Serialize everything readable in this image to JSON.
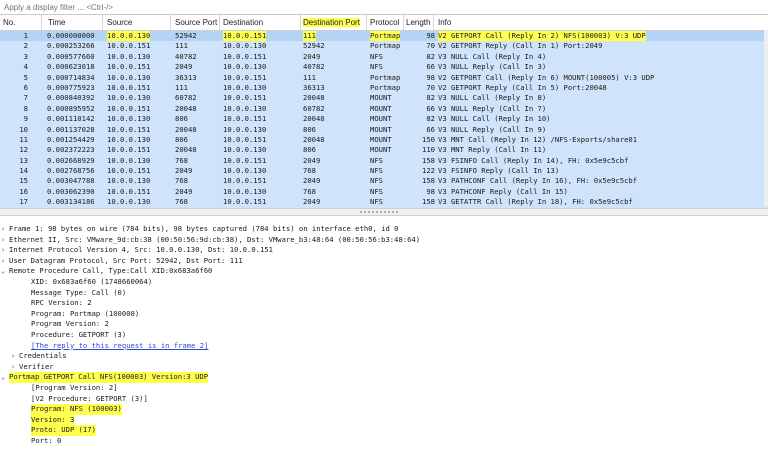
{
  "filter": {
    "placeholder": "Apply a display filter ... <Ctrl-/>"
  },
  "columns": {
    "no": "No.",
    "time": "Time",
    "source": "Source",
    "source_port": "Source Port",
    "destination": "Destination",
    "destination_port": "Destination Port",
    "protocol": "Protocol",
    "length": "Length",
    "info": "Info"
  },
  "packets": [
    {
      "no": "1",
      "time": "0.000000000",
      "src": "10.0.0.130",
      "sport": "52942",
      "dst": "10.0.0.151",
      "dport": "111",
      "proto": "Portmap",
      "len": "98",
      "info": "V2 GETPORT Call (Reply In 2) NFS(100003) V:3 UDP"
    },
    {
      "no": "2",
      "time": "0.000253266",
      "src": "10.0.0.151",
      "sport": "111",
      "dst": "10.0.0.130",
      "dport": "52942",
      "proto": "Portmap",
      "len": "70",
      "info": "V2 GETPORT Reply (Call In 1) Port:2049"
    },
    {
      "no": "3",
      "time": "0.000577660",
      "src": "10.0.0.130",
      "sport": "40782",
      "dst": "10.0.0.151",
      "dport": "2049",
      "proto": "NFS",
      "len": "82",
      "info": "V3 NULL Call (Reply In 4)"
    },
    {
      "no": "4",
      "time": "0.000623018",
      "src": "10.0.0.151",
      "sport": "2049",
      "dst": "10.0.0.130",
      "dport": "40782",
      "proto": "NFS",
      "len": "66",
      "info": "V3 NULL Reply (Call In 3)"
    },
    {
      "no": "5",
      "time": "0.000714834",
      "src": "10.0.0.130",
      "sport": "36313",
      "dst": "10.0.0.151",
      "dport": "111",
      "proto": "Portmap",
      "len": "98",
      "info": "V2 GETPORT Call (Reply In 6) MOUNT(100005) V:3 UDP"
    },
    {
      "no": "6",
      "time": "0.000775923",
      "src": "10.0.0.151",
      "sport": "111",
      "dst": "10.0.0.130",
      "dport": "36313",
      "proto": "Portmap",
      "len": "70",
      "info": "V2 GETPORT Reply (Call In 5) Port:20048"
    },
    {
      "no": "7",
      "time": "0.000840392",
      "src": "10.0.0.130",
      "sport": "60782",
      "dst": "10.0.0.151",
      "dport": "20048",
      "proto": "MOUNT",
      "len": "82",
      "info": "V3 NULL Call (Reply In 8)"
    },
    {
      "no": "8",
      "time": "0.000895952",
      "src": "10.0.0.151",
      "sport": "20048",
      "dst": "10.0.0.130",
      "dport": "60782",
      "proto": "MOUNT",
      "len": "66",
      "info": "V3 NULL Reply (Call In 7)"
    },
    {
      "no": "9",
      "time": "0.001110142",
      "src": "10.0.0.130",
      "sport": "806",
      "dst": "10.0.0.151",
      "dport": "20048",
      "proto": "MOUNT",
      "len": "82",
      "info": "V3 NULL Call (Reply In 10)"
    },
    {
      "no": "10",
      "time": "0.001137028",
      "src": "10.0.0.151",
      "sport": "20048",
      "dst": "10.0.0.130",
      "dport": "806",
      "proto": "MOUNT",
      "len": "66",
      "info": "V3 NULL Reply (Call In 9)"
    },
    {
      "no": "11",
      "time": "0.001254429",
      "src": "10.0.0.130",
      "sport": "806",
      "dst": "10.0.0.151",
      "dport": "20048",
      "proto": "MOUNT",
      "len": "150",
      "info": "V3 MNT Call (Reply In 12) /NFS-Exports/share01"
    },
    {
      "no": "12",
      "time": "0.002372223",
      "src": "10.0.0.151",
      "sport": "20048",
      "dst": "10.0.0.130",
      "dport": "806",
      "proto": "MOUNT",
      "len": "110",
      "info": "V3 MNT Reply (Call In 11)"
    },
    {
      "no": "13",
      "time": "0.002668929",
      "src": "10.0.0.130",
      "sport": "768",
      "dst": "10.0.0.151",
      "dport": "2049",
      "proto": "NFS",
      "len": "158",
      "info": "V3 FSINFO Call (Reply In 14), FH: 0x5e9c5cbf"
    },
    {
      "no": "14",
      "time": "0.002768756",
      "src": "10.0.0.151",
      "sport": "2049",
      "dst": "10.0.0.130",
      "dport": "768",
      "proto": "NFS",
      "len": "122",
      "info": "V3 FSINFO Reply (Call In 13)"
    },
    {
      "no": "15",
      "time": "0.003047788",
      "src": "10.0.0.130",
      "sport": "768",
      "dst": "10.0.0.151",
      "dport": "2049",
      "proto": "NFS",
      "len": "158",
      "info": "V3 PATHCONF Call (Reply In 16), FH: 0x5e9c5cbf"
    },
    {
      "no": "16",
      "time": "0.003062390",
      "src": "10.0.0.151",
      "sport": "2049",
      "dst": "10.0.0.130",
      "dport": "768",
      "proto": "NFS",
      "len": "98",
      "info": "V3 PATHCONF Reply (Call In 15)"
    },
    {
      "no": "17",
      "time": "0.003134186",
      "src": "10.0.0.130",
      "sport": "768",
      "dst": "10.0.0.151",
      "dport": "2049",
      "proto": "NFS",
      "len": "158",
      "info": "V3 GETATTR Call (Reply In 18), FH: 0x5e9c5cbf"
    }
  ],
  "details": [
    {
      "toggle": "›",
      "text": "Frame 1: 98 bytes on wire (784 bits), 98 bytes captured (784 bits) on interface eth0, id 0"
    },
    {
      "toggle": "›",
      "text": "Ethernet II, Src: VMware_9d:cb:38 (00:50:56:9d:cb:38), Dst: VMware_b3:48:64 (00:50:56:b3:48:64)"
    },
    {
      "toggle": "›",
      "text": "Internet Protocol Version 4, Src: 10.0.0.130, Dst: 10.0.0.151"
    },
    {
      "toggle": "›",
      "text": "User Datagram Protocol, Src Port: 52942, Dst Port: 111"
    },
    {
      "toggle": "⌄",
      "text": "Remote Procedure Call, Type:Call XID:0x683a6f60"
    },
    {
      "text": "XID: 0x683a6f60 (1748660064)"
    },
    {
      "text": "Message Type: Call (0)"
    },
    {
      "text": "RPC Version: 2"
    },
    {
      "text": "Program: Portmap (100000)"
    },
    {
      "text": "Program Version: 2"
    },
    {
      "text": "Procedure: GETPORT (3)"
    },
    {
      "text": "[The reply to this request is in frame 2]"
    },
    {
      "toggle": "›",
      "text": "Credentials"
    },
    {
      "toggle": "›",
      "text": "Verifier"
    },
    {
      "toggle": "⌄",
      "text": "Portmap GETPORT Call NFS(100003) Version:3 UDP"
    },
    {
      "text": "[Program Version: 2]"
    },
    {
      "text": "[V2 Procedure: GETPORT (3)]"
    },
    {
      "text": "Program: NFS (100003)"
    },
    {
      "text": "Version: 3"
    },
    {
      "text": "Proto: UDP (17)"
    },
    {
      "text": "Port: 0"
    }
  ],
  "colors": {
    "row_bg": "#d6e9ff",
    "selected_bg": "#b5d3f4",
    "highlight": "#ffff4d",
    "link": "#2a4bd6"
  }
}
